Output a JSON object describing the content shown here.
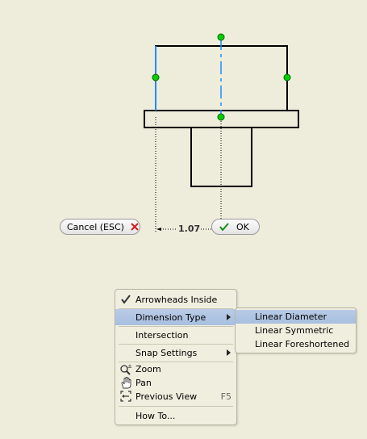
{
  "drawing": {
    "dimension_value": "1.07"
  },
  "buttons": {
    "cancel_label": "Cancel (ESC)",
    "ok_label": "OK"
  },
  "context_menu": {
    "items": [
      {
        "label": "Arrowheads Inside",
        "checked": true
      },
      {
        "label": "Dimension Type",
        "submenu": true,
        "highlighted": true
      },
      {
        "label": "Intersection"
      },
      {
        "label": "Snap Settings",
        "submenu": true
      },
      {
        "label": "Zoom",
        "icon": "zoom-icon"
      },
      {
        "label": "Pan",
        "icon": "pan-hand-icon"
      },
      {
        "label": "Previous View",
        "icon": "previous-view-icon",
        "shortcut": "F5"
      },
      {
        "label": "How To..."
      }
    ]
  },
  "submenu": {
    "items": [
      {
        "label": "Linear Diameter",
        "highlighted": true
      },
      {
        "label": "Linear Symmetric"
      },
      {
        "label": "Linear Foreshortened"
      }
    ]
  },
  "colors": {
    "background": "#eeecdb",
    "highlight": "#b2c7e4",
    "handle_green": "#00c800",
    "selected_blue": "#1e8cff",
    "cancel_red": "#d22020",
    "ok_green": "#1a8c1a"
  }
}
